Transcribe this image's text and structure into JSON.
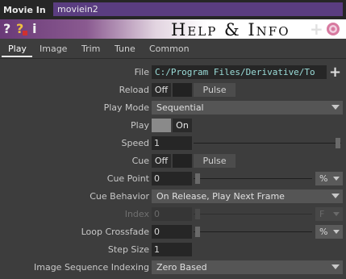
{
  "header": {
    "operator_type": "Movie In",
    "operator_name": "moviein2"
  },
  "helpbar": {
    "title": "Help & Info",
    "plus": "+"
  },
  "tabs": [
    "Play",
    "Image",
    "Trim",
    "Tune",
    "Common"
  ],
  "active_tab": "Play",
  "params": {
    "file": {
      "label": "File",
      "value": "C:/Program Files/Derivative/To"
    },
    "reload": {
      "label": "Reload",
      "state": "Off",
      "button": "Pulse"
    },
    "play_mode": {
      "label": "Play Mode",
      "value": "Sequential"
    },
    "play": {
      "label": "Play",
      "state": "On"
    },
    "speed": {
      "label": "Speed",
      "value": "1"
    },
    "cue": {
      "label": "Cue",
      "state": "Off",
      "button": "Pulse"
    },
    "cue_point": {
      "label": "Cue Point",
      "value": "0",
      "unit": "%"
    },
    "cue_behavior": {
      "label": "Cue Behavior",
      "value": "On Release, Play Next Frame"
    },
    "index": {
      "label": "Index",
      "value": "0",
      "unit": "F"
    },
    "loop_crossfade": {
      "label": "Loop Crossfade",
      "value": "0",
      "unit": "%"
    },
    "step_size": {
      "label": "Step Size",
      "value": "1"
    },
    "image_sequence_indexing": {
      "label": "Image Sequence Indexing",
      "value": "Zero Based"
    }
  }
}
